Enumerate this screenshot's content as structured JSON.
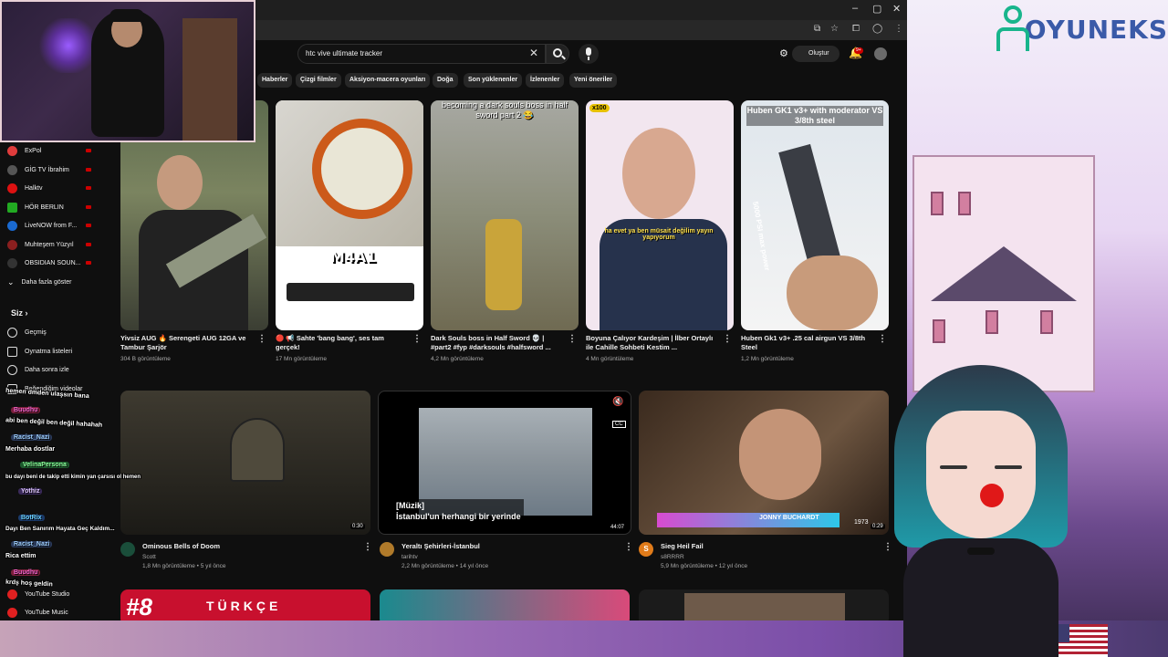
{
  "search": {
    "query": "htc vive ultimate tracker"
  },
  "header": {
    "create_label": "Oluştur",
    "notif_count": "9+"
  },
  "chips": [
    "Haberler",
    "Çizgi filmler",
    "Aksiyon-macera oyunları",
    "Doğa",
    "Son yüklenenler",
    "İzlenenler",
    "Yeni öneriler"
  ],
  "sidebar": {
    "subscriptions": [
      "ExPol",
      "GİG TV İbrahim",
      "Halktv",
      "HÖR BERLIN",
      "LiveNOW from F...",
      "Muhteşem Yüzyıl",
      "OBSIDIAN SOUN..."
    ],
    "show_more": "Daha fazla göster",
    "you_header": "Siz",
    "you_items": [
      "Geçmiş",
      "Oynatma listeleri",
      "Daha sonra izle",
      "Beğendiğim videolar"
    ],
    "bottom_items": [
      "YouTube Studio",
      "YouTube Music"
    ]
  },
  "videos_row1": [
    {
      "title_l1": "Yivsiz AUG 🔥 Serengeti AUG 12GA ve",
      "title_l2": "Tambur Şarjör",
      "meta": "304 B görüntüleme"
    },
    {
      "title_l1": "🔴 📢 Sahte 'bang bang', ses tam",
      "title_l2": "gerçek!",
      "meta": "17 Mn görüntüleme",
      "thumb_text": "M4A1"
    },
    {
      "title_l1": "Dark Souls boss in Half Sword 💀 |",
      "title_l2": "#part2 #fyp #darksouls #halfsword ...",
      "meta": "4,2 Mn görüntüleme",
      "thumb_text": "becoming a dark souls boss in half sword part 2 😂"
    },
    {
      "title_l1": "Boyuna Çalıyor Kardeşim | İlber Ortaylı",
      "title_l2": "ile Cahille Sohbeti Kestim ...",
      "meta": "4 Mn görüntüleme",
      "thumb_caption": "ha evet ya ben müsait değilim yayın yapıyorum",
      "badge": "x100"
    },
    {
      "title_l1": "Huben Gk1 v3+ .25 cal airgun VS 3/8th",
      "title_l2": "Steel",
      "meta": "1,2 Mn görüntüleme",
      "thumb_text": "Huben GK1 v3+ with moderator VS 3/8th steel",
      "thumb_side": "5000 PSI max power"
    }
  ],
  "videos_row2": [
    {
      "title": "Ominous Bells of Doom",
      "channel": "Scott",
      "meta": "1,8 Mn görüntüleme • 5 yıl önce",
      "duration": "0:30"
    },
    {
      "title": "Yeraltı Şehirleri-İstanbul",
      "channel": "tarihtv",
      "meta": "2,2 Mn görüntüleme • 14 yıl önce",
      "duration": "44:07",
      "caption_l1": "[Müzik]",
      "caption_l2": "İstanbul'un herhangi bir yerinde"
    },
    {
      "title": "Sieg Heil Fail",
      "channel": "s8RRRR",
      "meta": "5,9 Mn görüntüleme • 12 yıl önce",
      "duration": "0:29",
      "channel_initial": "S",
      "lower_third": "JONNY BUCHARDT",
      "corner_num": "1973"
    }
  ],
  "row3": {
    "left_text": "#8",
    "left_word": "TÜRKÇE"
  },
  "chat": [
    {
      "text": "hemen dmden ulaşsın bana"
    },
    {
      "name": "Buudhu"
    },
    {
      "text": "abi ben değil ben değil hahahah"
    },
    {
      "name": "Racist_Nazi"
    },
    {
      "text": "Merhaba dostlar"
    },
    {
      "name": "VelinaPersona"
    },
    {
      "text": "bu dayı beni de takip etti kimin yan çarsısı ol hemen"
    },
    {
      "name": "Yothiz"
    },
    {
      "name": "BotRix"
    },
    {
      "text": "Dayı Ben Sanırım Hayata Geç Kaldım..."
    },
    {
      "name": "Racist_Nazi"
    },
    {
      "text": "Rica ettim"
    },
    {
      "name": "Buudhu"
    },
    {
      "text": "krdş hoş geldin"
    }
  ],
  "brand": {
    "logo_text": "OYUNEKS"
  },
  "colors": {
    "accent_red": "#cc0000",
    "logo_green": "#18b58c",
    "logo_blue": "#3a5aa8"
  }
}
